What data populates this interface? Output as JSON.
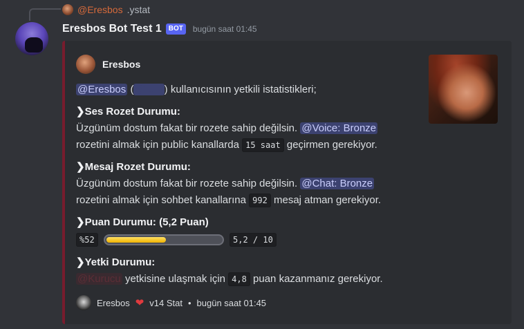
{
  "reply": {
    "author": "@Eresbos",
    "text": ".ystat"
  },
  "message": {
    "username": "Eresbos Bot Test 1",
    "bot_tag": "BOT",
    "timestamp": "bugün saat 01:45"
  },
  "embed": {
    "author": "Eresbos",
    "intro": {
      "mention": "@Eresbos",
      "open_paren": "(",
      "hidden_mention": "@......",
      "text": ") kullanıcısının yetkili istatistikleri;"
    },
    "voice": {
      "title": "Ses Rozet Durumu:",
      "line1": "Üzgünüm dostum fakat bir rozete sahip değilsin.",
      "role": "@Voice: Bronze",
      "line2_pre": "rozetini almak için public kanallarda",
      "code": "15 saat",
      "line2_post": "geçirmen gerekiyor."
    },
    "chat": {
      "title": "Mesaj Rozet Durumu:",
      "line1": "Üzgünüm dostum fakat bir rozete sahip değilsin.",
      "role": "@Chat: Bronze",
      "line2_pre": "rozetini almak için sohbet kanallarına",
      "code": "992",
      "line2_post": "mesaj atman gerekiyor."
    },
    "points": {
      "title": "Puan Durumu: (5,2 Puan)",
      "percent_label": "%52",
      "progress": 0.52,
      "score": "5,2 / 10"
    },
    "authority": {
      "title": "Yetki Durumu:",
      "role": "@Kurucu",
      "text_pre": "yetkisine ulaşmak için",
      "code": "4,8",
      "text_post": "puan kazanmanız gerekiyor."
    },
    "footer": {
      "name": "Eresbos",
      "heart": "❤",
      "stat": "v14 Stat",
      "separator": "•",
      "time": "bugün saat 01:45"
    }
  },
  "colors": {
    "background": "#313338",
    "embed_background": "#2b2d31",
    "embed_border": "#781c2d",
    "bot_tag": "#5865f2",
    "mention_bg": "#3c4270",
    "progress_fill": "#f0b300"
  }
}
